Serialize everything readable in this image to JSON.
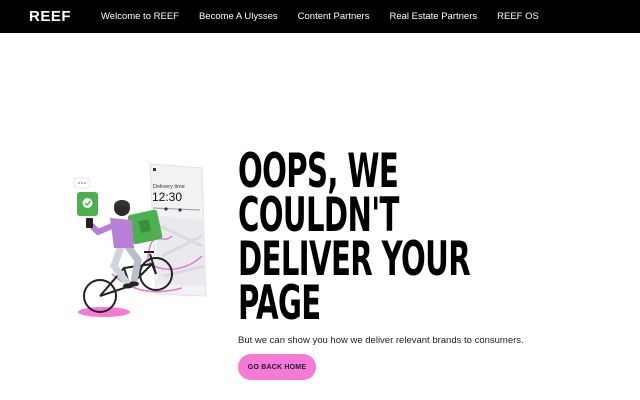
{
  "header": {
    "logo": "REEF",
    "nav": [
      {
        "label": "Welcome to REEF"
      },
      {
        "label": "Become A Ulysses"
      },
      {
        "label": "Content Partners"
      },
      {
        "label": "Real Estate Partners"
      },
      {
        "label": "REEF OS"
      }
    ]
  },
  "illustration": {
    "icon": "delivery-cyclist-illustration",
    "phone_title": "Delivery time",
    "phone_time": "12:30"
  },
  "main": {
    "headline_lines": [
      "OOPS, WE",
      "COULDN'T",
      "DELIVER YOUR",
      "PAGE"
    ],
    "subtext": "But we can show you how we deliver relevant brands to consumers.",
    "cta_label": "GO BACK HOME"
  },
  "colors": {
    "nav_bg": "#000000",
    "accent_pink": "#f57ad6",
    "green": "#4caf50",
    "purple": "#b97fd6"
  }
}
